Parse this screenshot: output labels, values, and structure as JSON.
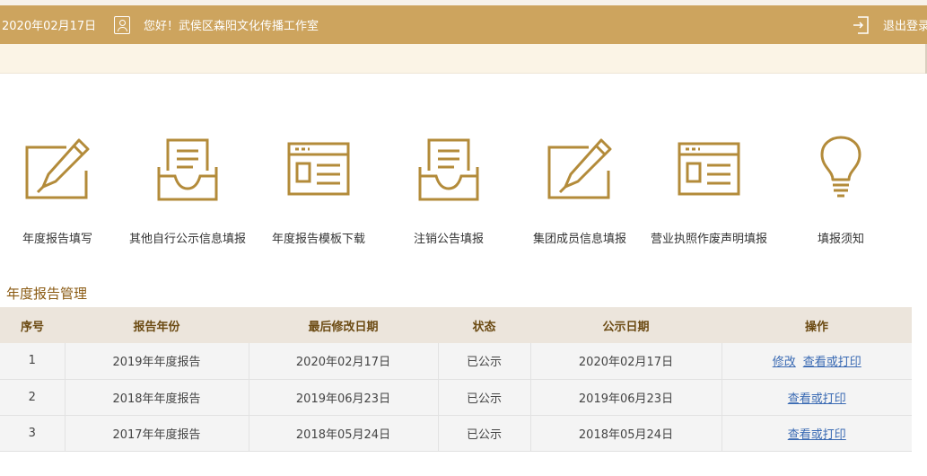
{
  "header": {
    "date": "2020年02月17日",
    "greeting": "您好！武侯区森阳文化传播工作室",
    "logout_label": "退出登录",
    "accent_color": "#cda45e"
  },
  "menu": [
    {
      "label": "年度报告填写",
      "icon": "edit-pencil-icon"
    },
    {
      "label": "其他自行公示信息填报",
      "icon": "inbox-tray-icon"
    },
    {
      "label": "年度报告模板下载",
      "icon": "template-window-icon"
    },
    {
      "label": "注销公告填报",
      "icon": "inbox-tray-icon"
    },
    {
      "label": "集团成员信息填报",
      "icon": "edit-pencil-icon"
    },
    {
      "label": "营业执照作废声明填报",
      "icon": "template-window-icon"
    },
    {
      "label": "填报须知",
      "icon": "lightbulb-icon"
    }
  ],
  "section_title": "年度报告管理",
  "table": {
    "headers": [
      "序号",
      "报告年份",
      "最后修改日期",
      "状态",
      "公示日期",
      "操作"
    ],
    "rows": [
      {
        "index": "1",
        "year": "2019年年度报告",
        "modified": "2020年02月17日",
        "status": "已公示",
        "published": "2020年02月17日",
        "actions": [
          "修改",
          "查看或打印"
        ]
      },
      {
        "index": "2",
        "year": "2018年年度报告",
        "modified": "2019年06月23日",
        "status": "已公示",
        "published": "2019年06月23日",
        "actions": [
          "查看或打印"
        ]
      },
      {
        "index": "3",
        "year": "2017年年度报告",
        "modified": "2018年05月24日",
        "status": "已公示",
        "published": "2018年05月24日",
        "actions": [
          "查看或打印"
        ]
      }
    ]
  }
}
